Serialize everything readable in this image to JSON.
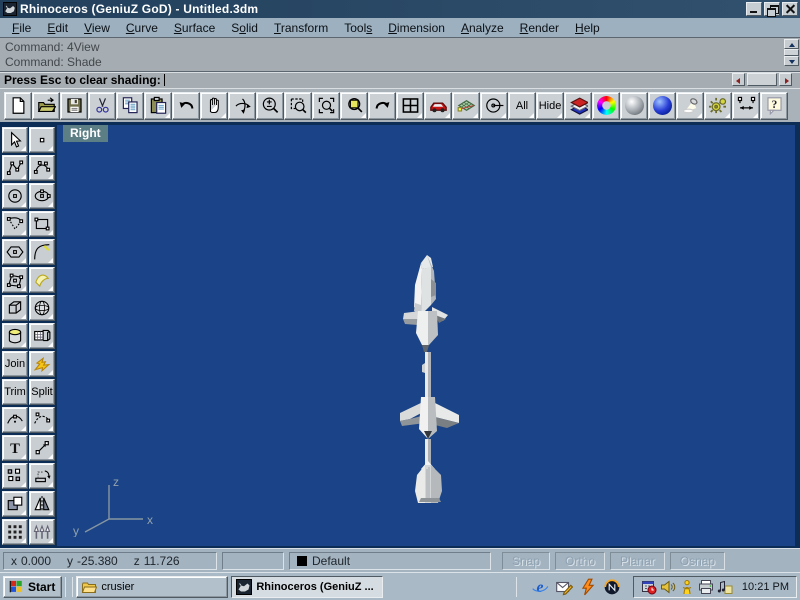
{
  "window": {
    "title": "Rhinoceros (GeniuZ GoD) - Untitled.3dm"
  },
  "menu": {
    "items": [
      {
        "label": "File",
        "underline": 0
      },
      {
        "label": "Edit",
        "underline": 0
      },
      {
        "label": "View",
        "underline": 0
      },
      {
        "label": "Curve",
        "underline": 0
      },
      {
        "label": "Surface",
        "underline": 0
      },
      {
        "label": "Solid",
        "underline": 1
      },
      {
        "label": "Transform",
        "underline": 0
      },
      {
        "label": "Tools",
        "underline": 4
      },
      {
        "label": "Dimension",
        "underline": 0
      },
      {
        "label": "Analyze",
        "underline": 0
      },
      {
        "label": "Render",
        "underline": 0
      },
      {
        "label": "Help",
        "underline": 0
      }
    ]
  },
  "command": {
    "history": [
      "Command: 4View",
      "Command: Shade"
    ],
    "prompt": "Press Esc to clear shading:"
  },
  "toolbar": {
    "buttons": [
      {
        "name": "new",
        "icon": "new"
      },
      {
        "name": "open",
        "icon": "open"
      },
      {
        "name": "save",
        "icon": "save"
      },
      {
        "name": "cut",
        "icon": "cut"
      },
      {
        "name": "copy",
        "icon": "copy"
      },
      {
        "name": "paste",
        "icon": "paste",
        "flyout": true
      },
      {
        "name": "undo",
        "icon": "undo"
      },
      {
        "name": "pan",
        "icon": "pan",
        "flyout": true
      },
      {
        "name": "rotate-view",
        "icon": "rotateview"
      },
      {
        "name": "zoom",
        "icon": "zoompm"
      },
      {
        "name": "zoom-window",
        "icon": "zoomwin"
      },
      {
        "name": "zoom-selected",
        "icon": "zoomsel"
      },
      {
        "name": "zoom-extents",
        "icon": "zoomext",
        "flyout": true
      },
      {
        "name": "undo-view",
        "icon": "undoview"
      },
      {
        "name": "viewport-layout",
        "icon": "fourview",
        "flyout": true
      },
      {
        "name": "car-sample",
        "icon": "car",
        "flyout": true
      },
      {
        "name": "mesh",
        "icon": "mesh",
        "flyout": true
      },
      {
        "name": "radius-tool",
        "icon": "radius",
        "flyout": true
      },
      {
        "name": "zoom-all",
        "label": "All",
        "flyout": true
      },
      {
        "name": "hide",
        "label": "Hide",
        "flyout": true
      },
      {
        "name": "layers",
        "icon": "layers",
        "flyout": true
      },
      {
        "name": "color-picker",
        "icon": "colorwheel"
      },
      {
        "name": "shade",
        "icon": "shadesphere"
      },
      {
        "name": "render",
        "icon": "rendersphere"
      },
      {
        "name": "spotlight",
        "icon": "spotlight",
        "flyout": true
      },
      {
        "name": "options",
        "icon": "gears",
        "flyout": true
      },
      {
        "name": "dimension",
        "icon": "dimension",
        "flyout": true
      },
      {
        "name": "help",
        "icon": "help"
      }
    ]
  },
  "left_toolbar": {
    "buttons": [
      {
        "name": "select",
        "icon": "select"
      },
      {
        "name": "point",
        "icon": "point"
      },
      {
        "name": "polyline",
        "icon": "polyline"
      },
      {
        "name": "curve",
        "icon": "curve"
      },
      {
        "name": "circle",
        "icon": "circle"
      },
      {
        "name": "ellipse",
        "icon": "ellipse"
      },
      {
        "name": "arc",
        "icon": "arc"
      },
      {
        "name": "rectangle",
        "icon": "rectangle"
      },
      {
        "name": "polygon",
        "icon": "polygon"
      },
      {
        "name": "fillet",
        "icon": "fillet"
      },
      {
        "name": "surface-points",
        "icon": "srfpts"
      },
      {
        "name": "surface-tools",
        "icon": "srf"
      },
      {
        "name": "box",
        "icon": "box"
      },
      {
        "name": "sphere",
        "icon": "sphere"
      },
      {
        "name": "cylinder",
        "icon": "cylinder"
      },
      {
        "name": "solid-tools",
        "icon": "solids"
      },
      {
        "name": "join",
        "label": "Join"
      },
      {
        "name": "explode",
        "icon": "explode"
      },
      {
        "name": "trim",
        "label": "Trim"
      },
      {
        "name": "split",
        "label": "Split"
      },
      {
        "name": "curve-edit-1",
        "icon": "curvept1"
      },
      {
        "name": "curve-edit-2",
        "icon": "curvept2"
      },
      {
        "name": "text",
        "icon": "textT"
      },
      {
        "name": "move",
        "icon": "move"
      },
      {
        "name": "copy-objects",
        "icon": "squares"
      },
      {
        "name": "rotate",
        "icon": "rotate2d"
      },
      {
        "name": "scale",
        "icon": "overlap"
      },
      {
        "name": "mirror",
        "icon": "mirror"
      },
      {
        "name": "array",
        "icon": "array"
      },
      {
        "name": "extrude",
        "icon": "extrude"
      }
    ]
  },
  "viewport": {
    "label": "Right",
    "bg_color": "#1a4487",
    "axis": {
      "x": "x",
      "y": "y",
      "z": "z"
    }
  },
  "status": {
    "x_label": "x",
    "x_value": "0.000",
    "y_label": "y",
    "y_value": "-25.380",
    "z_label": "z",
    "z_value": "11.726",
    "layer_name": "Default",
    "layer_color": "#000000",
    "toggles": [
      "Snap",
      "Ortho",
      "Planar",
      "Osnap"
    ]
  },
  "taskbar": {
    "start_label": "Start",
    "tasks": [
      {
        "label": "crusier",
        "icon": "folder",
        "active": false
      },
      {
        "label": "Rhinoceros (GeniuZ ...",
        "icon": "rhino",
        "active": true
      }
    ],
    "quick_launch": [
      "ie",
      "mail",
      "winamp",
      "netscape"
    ],
    "tray_icons": [
      "scheduler",
      "volume",
      "icq",
      "printer",
      "audnote"
    ],
    "clock": "10:21 PM"
  }
}
